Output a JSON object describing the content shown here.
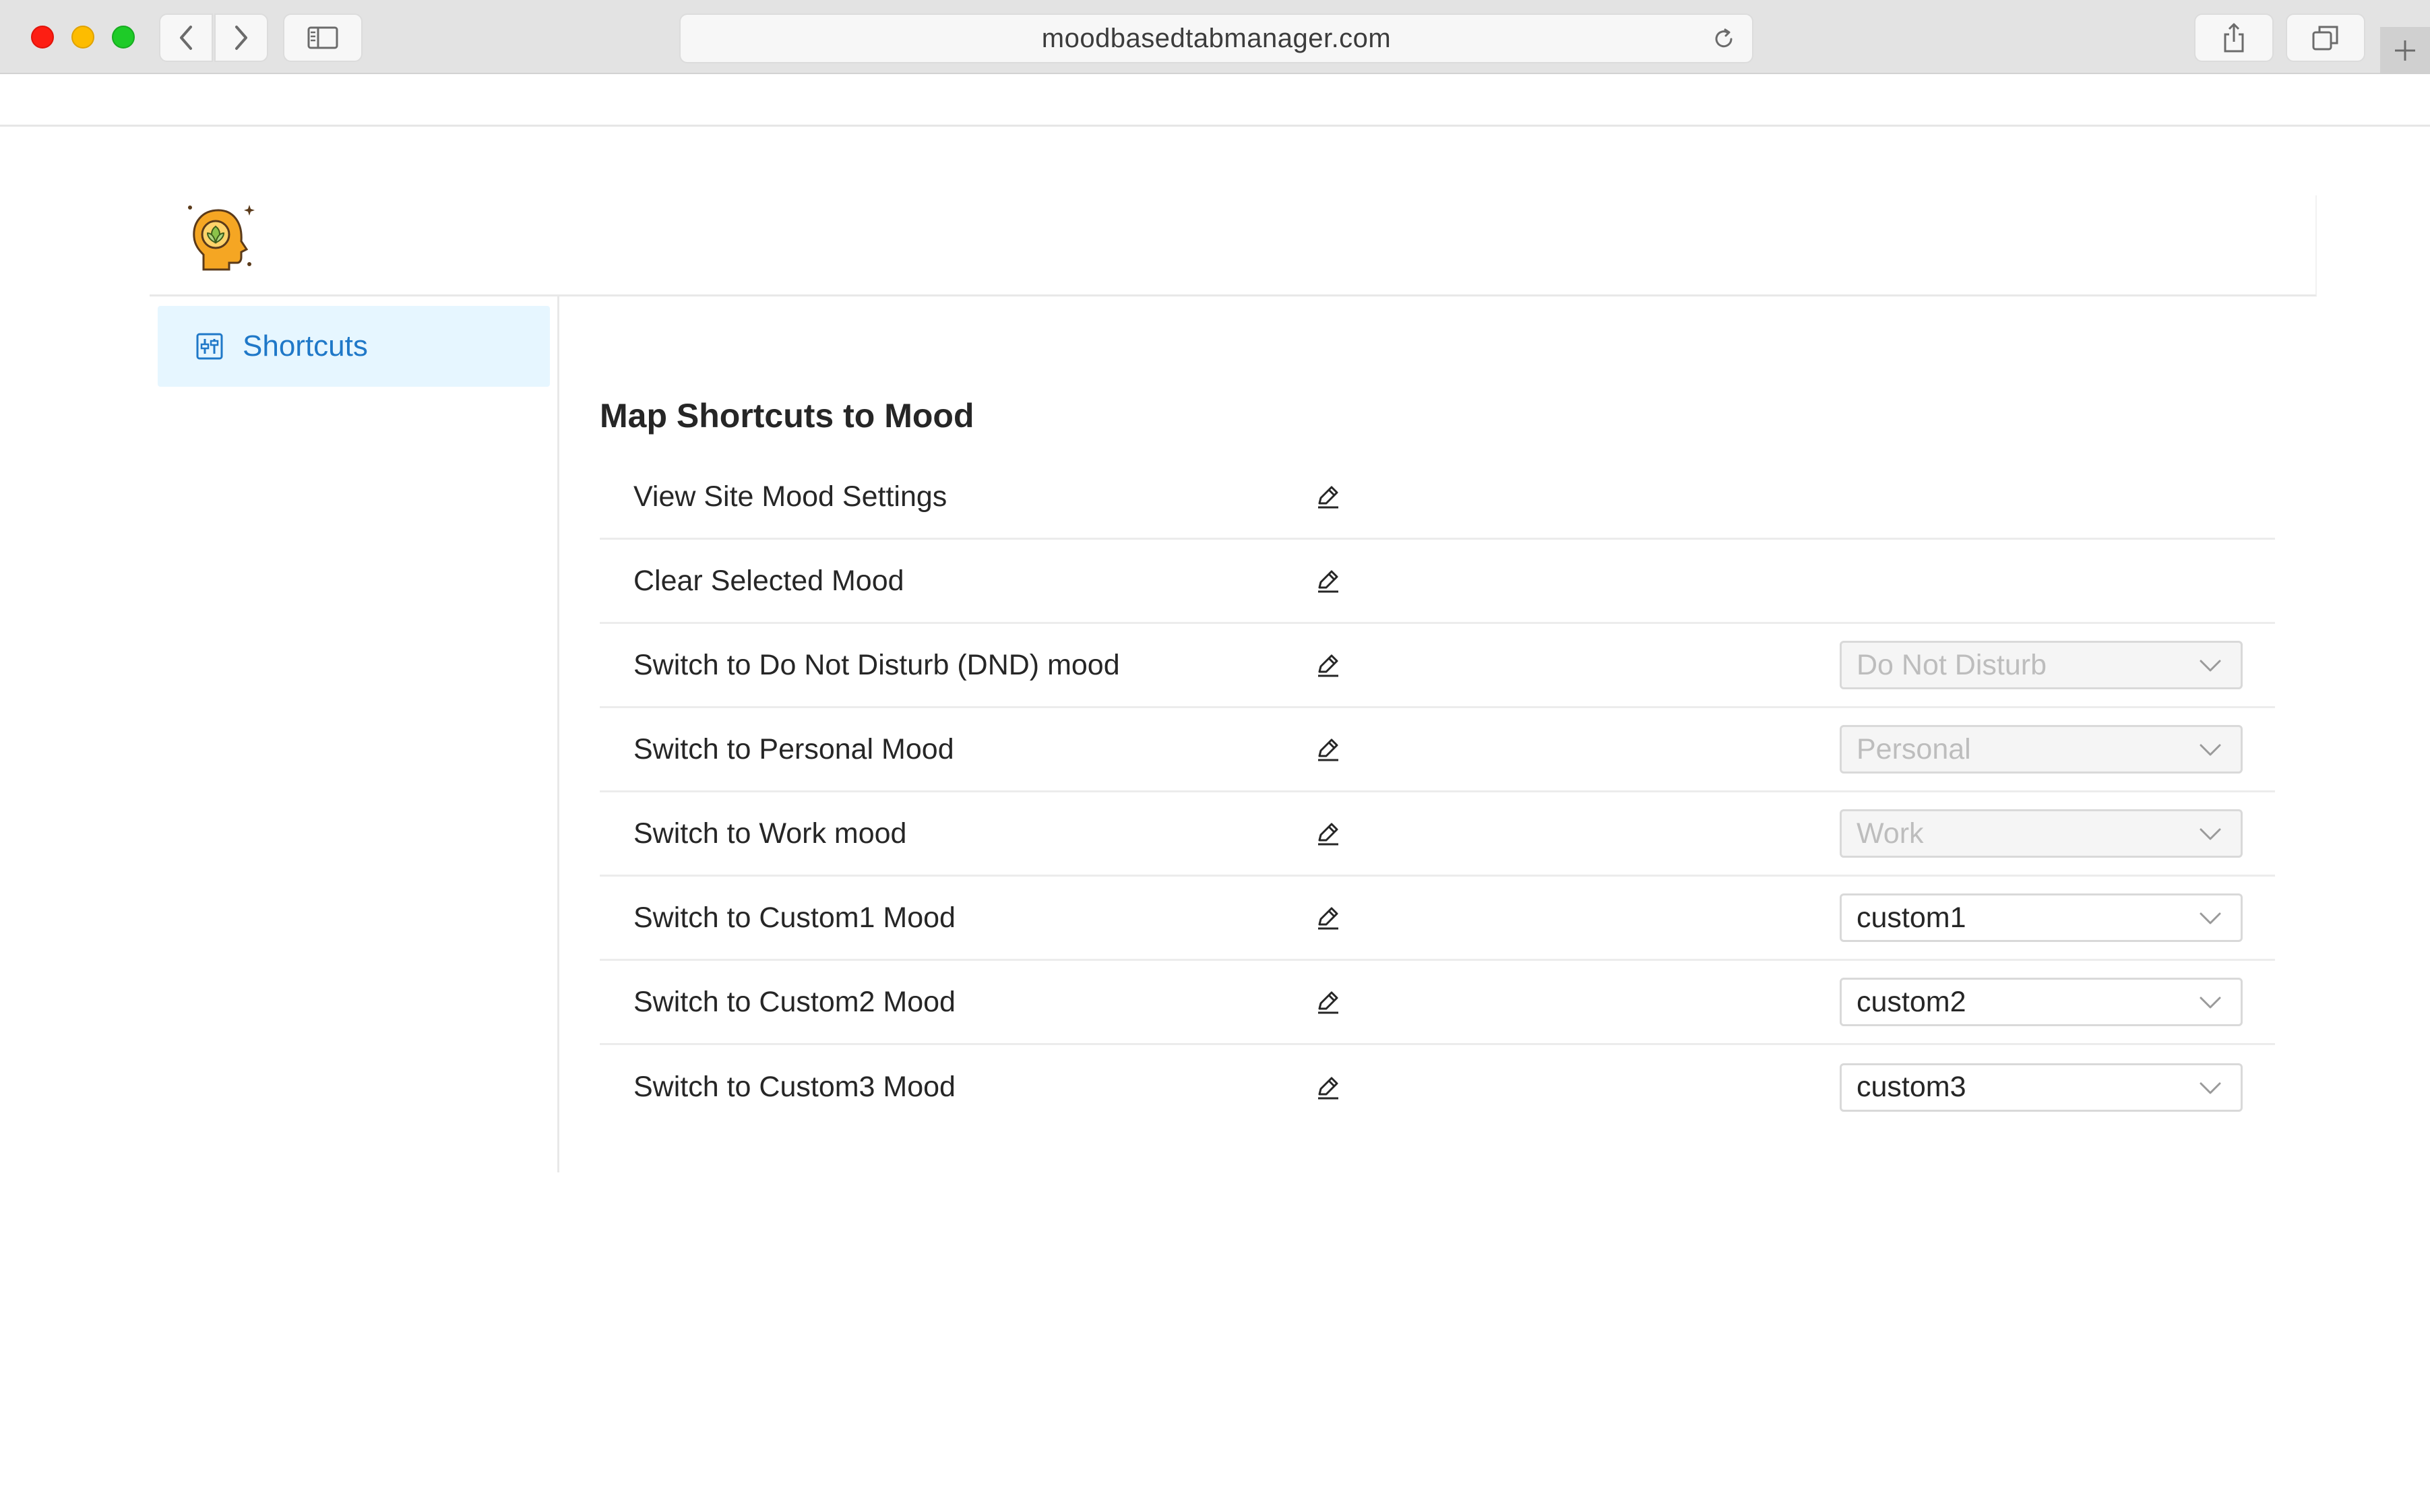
{
  "browser": {
    "url": "moodbasedtabmanager.com"
  },
  "sidebar": {
    "items": [
      {
        "label": "Shortcuts",
        "icon": "sliders-icon",
        "active": true
      }
    ]
  },
  "main": {
    "title": "Map Shortcuts to Mood",
    "rows": [
      {
        "label": "View Site Mood Settings",
        "mood": null,
        "disabled": false
      },
      {
        "label": "Clear Selected Mood",
        "mood": null,
        "disabled": false
      },
      {
        "label": "Switch to Do Not Disturb (DND) mood",
        "mood": "Do Not Disturb",
        "disabled": true
      },
      {
        "label": "Switch to Personal Mood",
        "mood": "Personal",
        "disabled": true
      },
      {
        "label": "Switch to Work mood",
        "mood": "Work",
        "disabled": true
      },
      {
        "label": "Switch to Custom1 Mood",
        "mood": "custom1",
        "disabled": false
      },
      {
        "label": "Switch to Custom2 Mood",
        "mood": "custom2",
        "disabled": false
      },
      {
        "label": "Switch to Custom3 Mood",
        "mood": "custom3",
        "disabled": false
      }
    ]
  },
  "colors": {
    "accent": "#1f78c8",
    "active_nav_bg": "#e6f6ff",
    "logo_orange": "#f5a623",
    "logo_green": "#8bc34a"
  }
}
